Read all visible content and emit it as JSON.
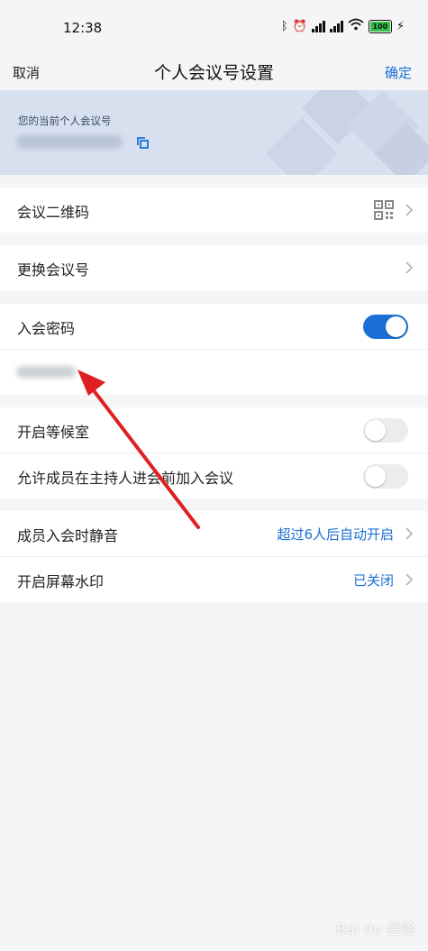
{
  "status_bar": {
    "time": "12:38",
    "battery": "100"
  },
  "nav": {
    "cancel_label": "取消",
    "title": "个人会议号设置",
    "confirm_label": "确定"
  },
  "banner": {
    "label": "您的当前个人会议号"
  },
  "rows": {
    "qr_code": {
      "label": "会议二维码"
    },
    "change_number": {
      "label": "更换会议号"
    },
    "meeting_password": {
      "label": "入会密码",
      "enabled": true
    },
    "waiting_room": {
      "label": "开启等候室",
      "enabled": false
    },
    "join_before_host": {
      "label": "允许成员在主持人进会前加入会议",
      "enabled": false
    },
    "mute_on_entry": {
      "label": "成员入会时静音",
      "value": "超过6人后自动开启"
    },
    "watermark": {
      "label": "开启屏幕水印",
      "value": "已关闭"
    }
  },
  "colors": {
    "accent": "#1a6fd6",
    "arrow": "#e02020",
    "banner_bg": "#d7e0ef"
  }
}
